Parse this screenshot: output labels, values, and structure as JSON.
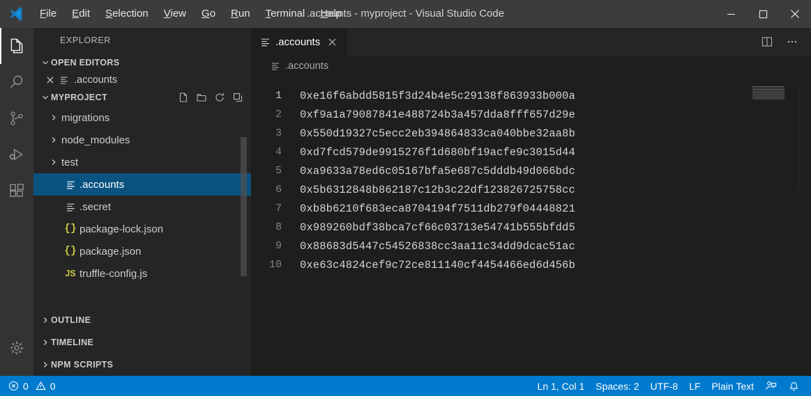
{
  "titlebar": {
    "logo_icon": "vscode-logo-icon",
    "title": ".accounts - myproject - Visual Studio Code",
    "menus": [
      {
        "label": "File",
        "mnemonic": "F"
      },
      {
        "label": "Edit",
        "mnemonic": "E"
      },
      {
        "label": "Selection",
        "mnemonic": "S"
      },
      {
        "label": "View",
        "mnemonic": "V"
      },
      {
        "label": "Go",
        "mnemonic": "G"
      },
      {
        "label": "Run",
        "mnemonic": "R"
      },
      {
        "label": "Terminal",
        "mnemonic": "T"
      },
      {
        "label": "Help",
        "mnemonic": "H"
      }
    ],
    "window_controls": {
      "minimize": "minimize-icon",
      "maximize": "maximize-icon",
      "close": "close-icon"
    }
  },
  "activitybar": {
    "items": [
      {
        "name": "explorer",
        "icon": "files-icon",
        "active": true
      },
      {
        "name": "search",
        "icon": "search-icon",
        "active": false
      },
      {
        "name": "source-control",
        "icon": "source-control-icon",
        "active": false
      },
      {
        "name": "run-and-debug",
        "icon": "run-debug-icon",
        "active": false
      },
      {
        "name": "extensions",
        "icon": "extensions-icon",
        "active": false
      }
    ],
    "bottom": [
      {
        "name": "manage",
        "icon": "gear-icon",
        "active": false
      }
    ]
  },
  "sidebar": {
    "title": "EXPLORER",
    "open_editors": {
      "label": "OPEN EDITORS",
      "expanded": true,
      "items": [
        {
          "name": ".accounts",
          "icon": "file-text-icon",
          "close_icon": "close-icon"
        }
      ]
    },
    "project": {
      "label": "MYPROJECT",
      "expanded": true,
      "actions": [
        {
          "name": "new-file",
          "icon": "new-file-icon"
        },
        {
          "name": "new-folder",
          "icon": "new-folder-icon"
        },
        {
          "name": "refresh",
          "icon": "refresh-icon"
        },
        {
          "name": "collapse-all",
          "icon": "collapse-all-icon"
        }
      ],
      "tree": [
        {
          "name": "migrations",
          "type": "folder",
          "expanded": false,
          "icon": "chevron-right-icon",
          "selected": false
        },
        {
          "name": "node_modules",
          "type": "folder",
          "expanded": false,
          "icon": "chevron-right-icon",
          "selected": false
        },
        {
          "name": "test",
          "type": "folder",
          "expanded": false,
          "icon": "chevron-right-icon",
          "selected": false
        },
        {
          "name": ".accounts",
          "type": "file",
          "icon": "file-text-icon",
          "selected": true
        },
        {
          "name": ".secret",
          "type": "file",
          "icon": "file-text-icon",
          "selected": false
        },
        {
          "name": "package-lock.json",
          "type": "file",
          "icon": "json-icon",
          "icon_text": "{}",
          "selected": false
        },
        {
          "name": "package.json",
          "type": "file",
          "icon": "json-icon",
          "icon_text": "{}",
          "selected": false
        },
        {
          "name": "truffle-config.js",
          "type": "file",
          "icon": "js-icon",
          "icon_text": "JS",
          "selected": false
        }
      ]
    },
    "bottom_sections": [
      {
        "label": "OUTLINE",
        "expanded": false
      },
      {
        "label": "TIMELINE",
        "expanded": false
      },
      {
        "label": "NPM SCRIPTS",
        "expanded": false
      }
    ]
  },
  "editor": {
    "tabs": [
      {
        "label": ".accounts",
        "icon": "file-text-icon",
        "active": true,
        "close_icon": "close-icon"
      }
    ],
    "tab_actions": [
      {
        "name": "split-editor",
        "icon": "split-editor-icon"
      },
      {
        "name": "more-actions",
        "icon": "ellipsis-icon"
      }
    ],
    "breadcrumb": {
      "icon": "file-text-icon",
      "label": ".accounts"
    },
    "lines": [
      {
        "number": "1",
        "text": "0xe16f6abdd5815f3d24b4e5c29138f863933b000a"
      },
      {
        "number": "2",
        "text": "0xf9a1a79087841e488724b3a457dda8fff657d29e"
      },
      {
        "number": "3",
        "text": "0x550d19327c5ecc2eb394864833ca040bbe32aa8b"
      },
      {
        "number": "4",
        "text": "0xd7fcd579de9915276f1d680bf19acfe9c3015d44"
      },
      {
        "number": "5",
        "text": "0xa9633a78ed6c05167bfa5e687c5dddb49d066bdc"
      },
      {
        "number": "6",
        "text": "0x5b6312848b862187c12b3c22df123826725758cc"
      },
      {
        "number": "7",
        "text": "0xb8b6210f683eca8704194f7511db279f04448821"
      },
      {
        "number": "8",
        "text": "0x989260bdf38bca7cf66c03713e54741b555bfdd5"
      },
      {
        "number": "9",
        "text": "0x88683d5447c54526838cc3aa11c34dd9dcac51ac"
      },
      {
        "number": "10",
        "text": "0xe63c4824cef9c72ce811140cf4454466ed6d456b"
      }
    ],
    "minimap_lines": 10
  },
  "statusbar": {
    "errors": {
      "icon": "error-icon",
      "count": "0"
    },
    "warnings": {
      "icon": "warning-icon",
      "count": "0"
    },
    "cursor_position": "Ln 1, Col 1",
    "indentation": "Spaces: 2",
    "encoding": "UTF-8",
    "eol": "LF",
    "language_mode": "Plain Text",
    "feedback_icon": "feedback-person-icon",
    "notifications_icon": "bell-icon"
  },
  "colors": {
    "titlebar_bg": "#3c3c3c",
    "activitybar_bg": "#333333",
    "sidebar_bg": "#252526",
    "editor_bg": "#1e1e1e",
    "statusbar_bg": "#007acc",
    "selection_blue": "#0a5380",
    "json_yellow": "#cbcb41"
  }
}
